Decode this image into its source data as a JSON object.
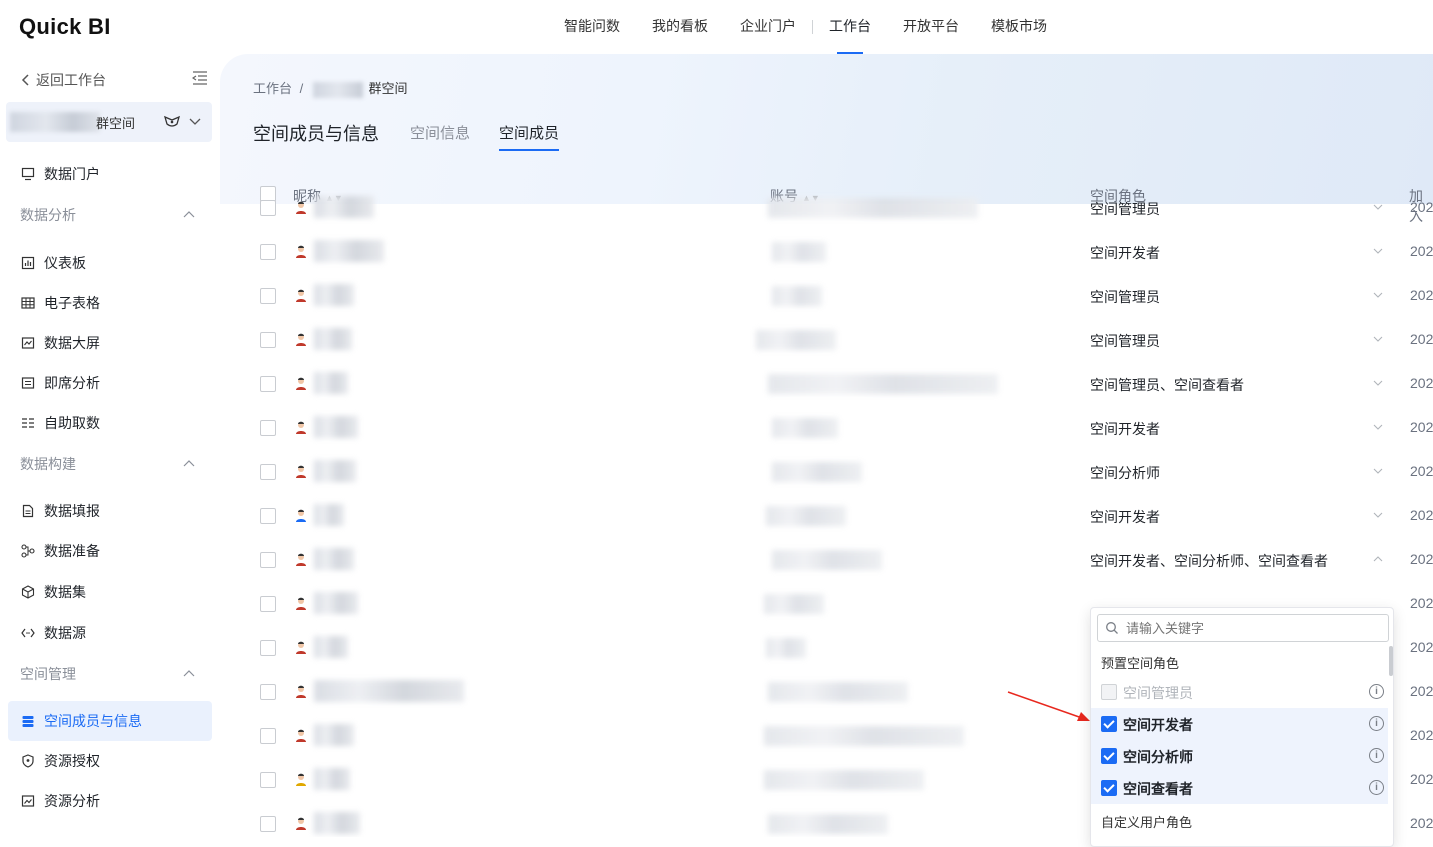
{
  "app": {
    "logo": "Quick BI"
  },
  "topnav": {
    "items": [
      "智能问数",
      "我的看板",
      "企业门户",
      "工作台",
      "开放平台",
      "模板市场"
    ],
    "active": "工作台"
  },
  "sidebar": {
    "back": "返回工作台",
    "workspace_name": "群空间",
    "items": {
      "portal": "数据门户",
      "group_analysis": "数据分析",
      "dashboard": "仪表板",
      "spreadsheet": "电子表格",
      "screen": "数据大屏",
      "adhoc": "即席分析",
      "selfservice": "自助取数",
      "group_build": "数据构建",
      "fill": "数据填报",
      "prepare": "数据准备",
      "dataset": "数据集",
      "datasource": "数据源",
      "group_space": "空间管理",
      "members": "空间成员与信息",
      "auth": "资源授权",
      "resource": "资源分析"
    }
  },
  "main": {
    "breadcrumb": {
      "root": "工作台",
      "sep": "/",
      "current": "群空间"
    },
    "title": "空间成员与信息",
    "tabs": [
      "空间信息",
      "空间成员"
    ],
    "active_tab": "空间成员",
    "columns": {
      "nickname": "昵称",
      "account": "账号",
      "role": "空间角色",
      "join": "加入"
    },
    "rows": [
      {
        "role": "空间管理员",
        "date": "202"
      },
      {
        "role": "空间开发者",
        "date": "202"
      },
      {
        "role": "空间管理员",
        "date": "202"
      },
      {
        "role": "空间管理员",
        "date": "202"
      },
      {
        "role": "空间管理员、空间查看者",
        "date": "202"
      },
      {
        "role": "空间开发者",
        "date": "202"
      },
      {
        "role": "空间分析师",
        "date": "202"
      },
      {
        "role": "空间开发者",
        "date": "202"
      },
      {
        "role": "空间开发者、空间分析师、空间查看者",
        "date": "202"
      },
      {
        "role": "",
        "date": "202"
      },
      {
        "role": "",
        "date": "202"
      },
      {
        "role": "",
        "date": "202"
      },
      {
        "role": "",
        "date": "202"
      },
      {
        "role": "",
        "date": "202"
      },
      {
        "role": "",
        "date": "202"
      }
    ]
  },
  "dropdown": {
    "search_placeholder": "请输入关键字",
    "group_preset": "预置空间角色",
    "options": [
      {
        "label": "空间管理员",
        "state": "disabled"
      },
      {
        "label": "空间开发者",
        "state": "checked"
      },
      {
        "label": "空间分析师",
        "state": "checked"
      },
      {
        "label": "空间查看者",
        "state": "checked"
      }
    ],
    "group_custom": "自定义用户角色"
  },
  "colors": {
    "accent": "#1b6bf4",
    "arrow": "#e8281e"
  }
}
